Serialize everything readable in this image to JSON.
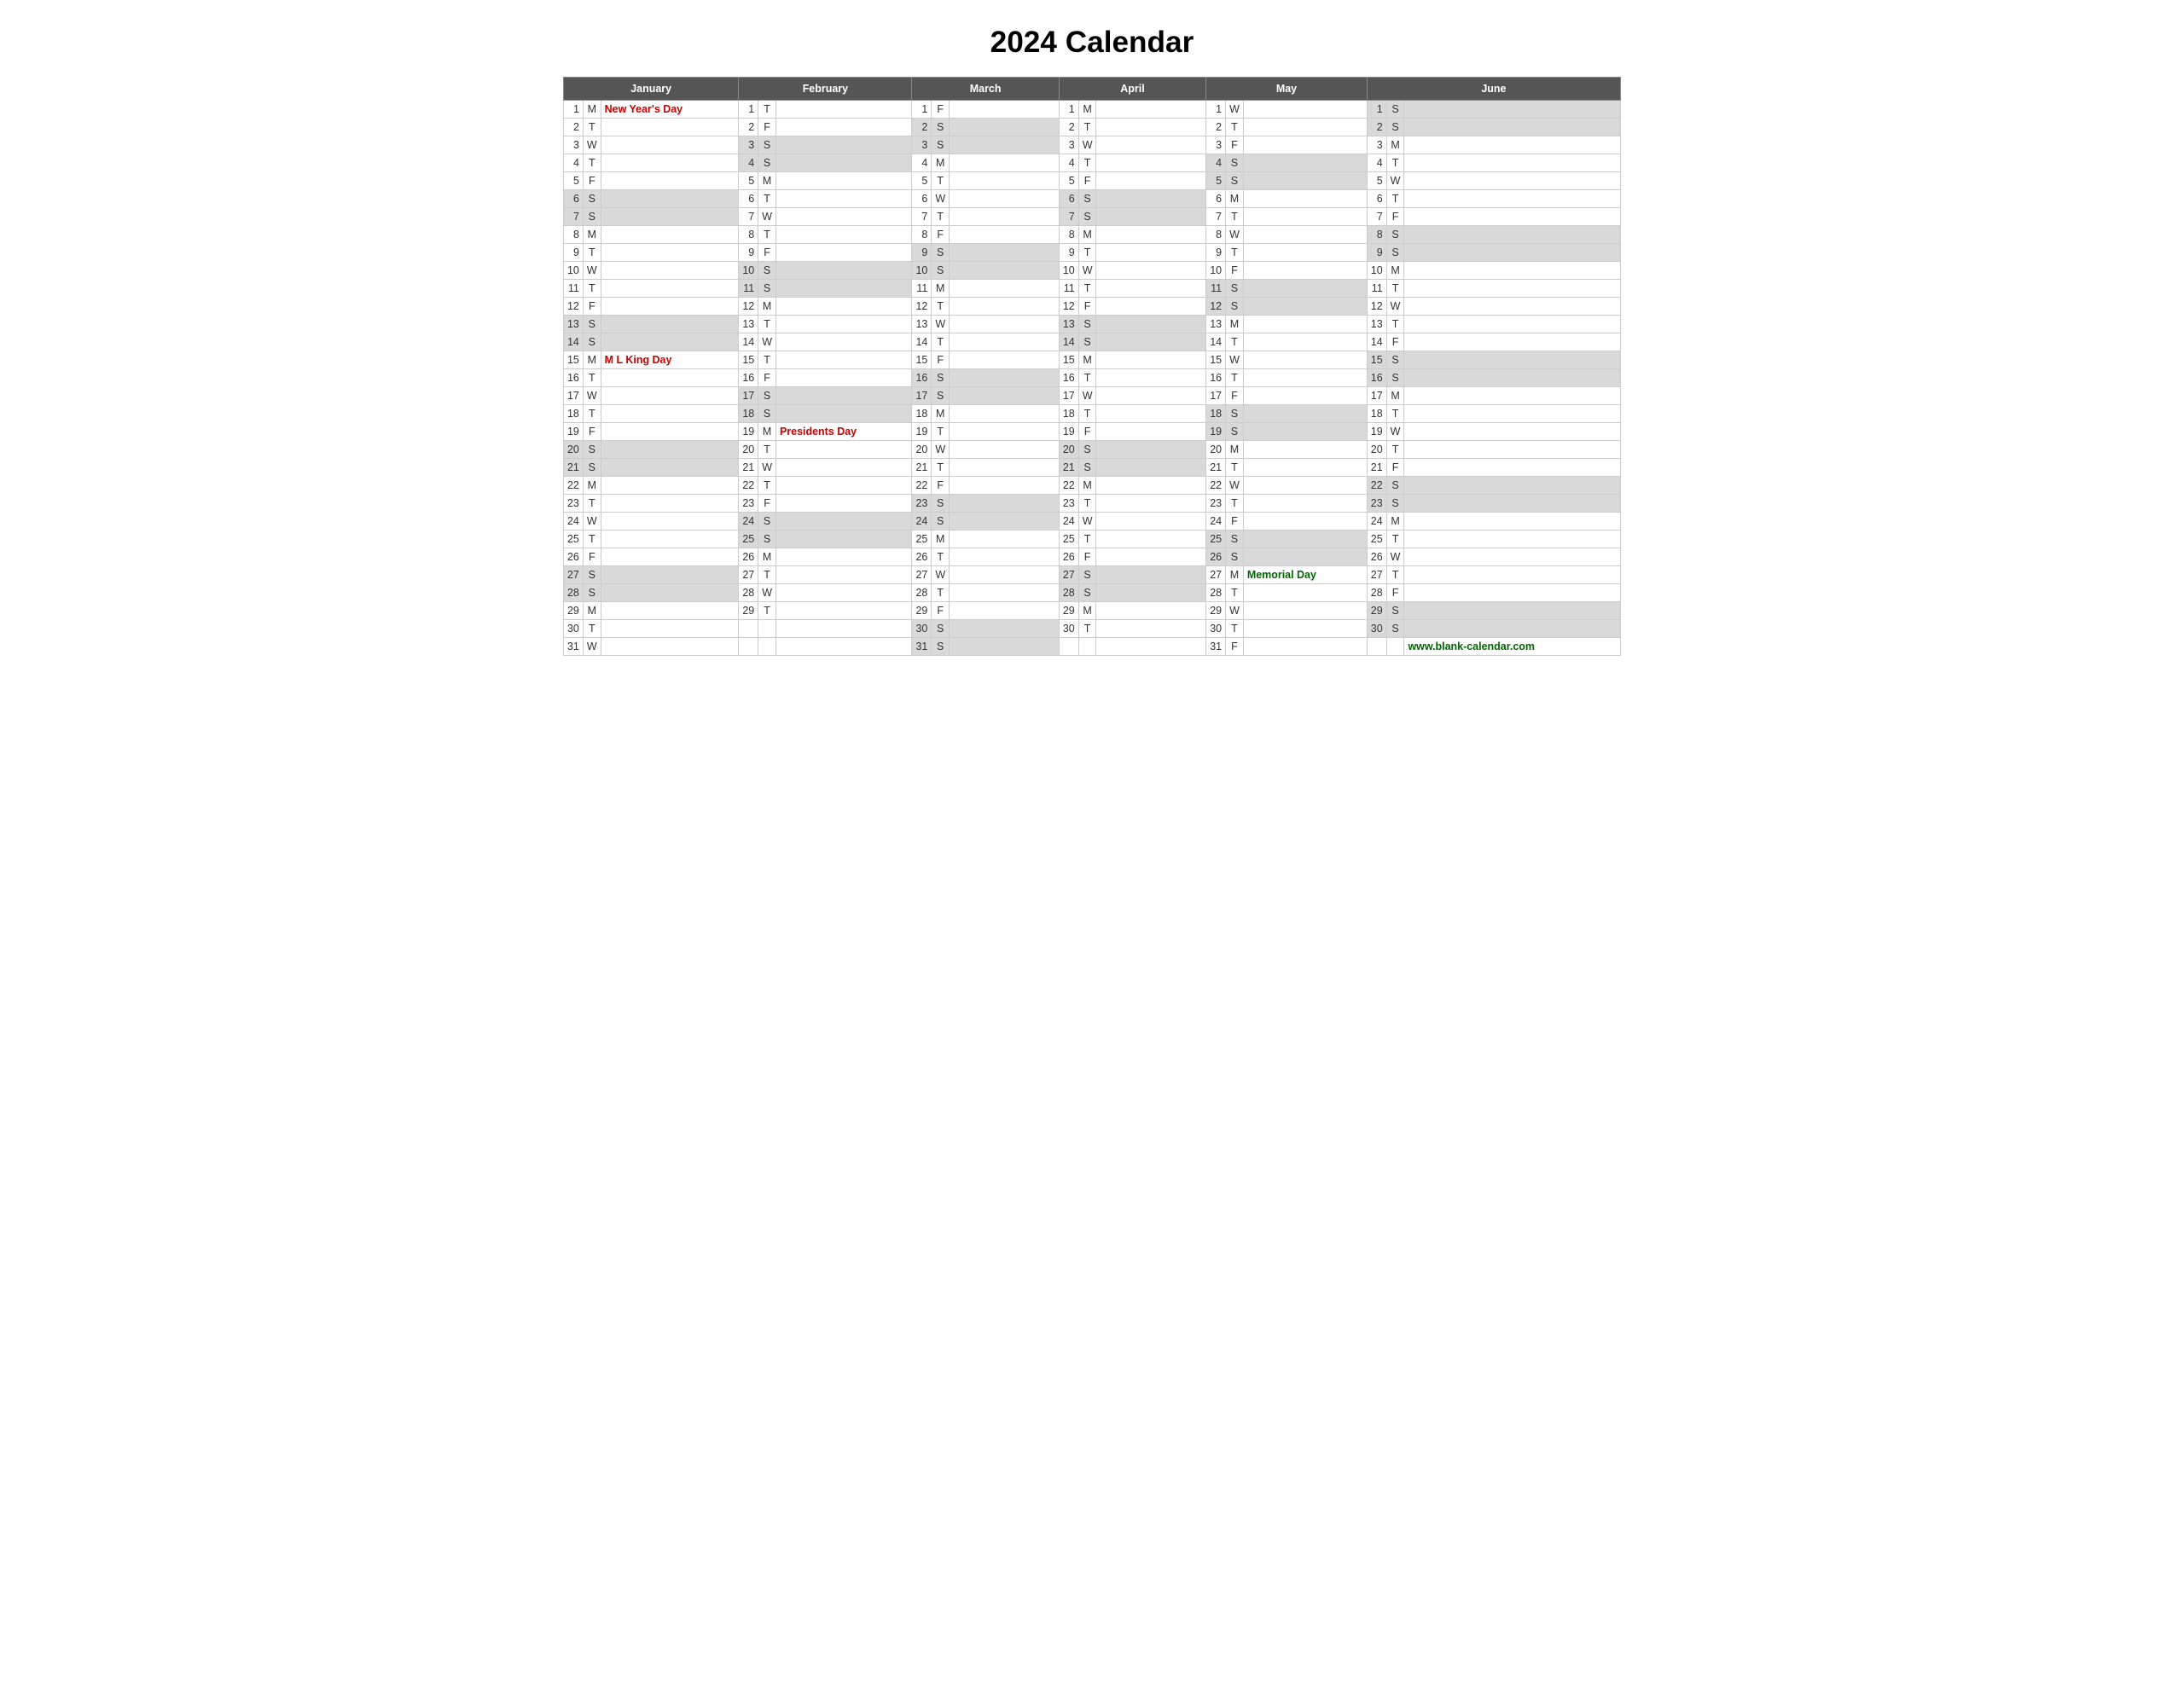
{
  "title": "2024 Calendar",
  "footer": "www.blank-calendar.com",
  "months": [
    "January",
    "February",
    "March",
    "April",
    "May",
    "June"
  ],
  "calendar": {
    "january": [
      {
        "day": 1,
        "letter": "M",
        "event": "New Year's Day",
        "event_class": "holiday-red",
        "weekend": false
      },
      {
        "day": 2,
        "letter": "T",
        "event": "",
        "weekend": false
      },
      {
        "day": 3,
        "letter": "W",
        "event": "",
        "weekend": false
      },
      {
        "day": 4,
        "letter": "T",
        "event": "",
        "weekend": false
      },
      {
        "day": 5,
        "letter": "F",
        "event": "",
        "weekend": false
      },
      {
        "day": 6,
        "letter": "S",
        "event": "",
        "weekend": true
      },
      {
        "day": 7,
        "letter": "S",
        "event": "",
        "weekend": true
      },
      {
        "day": 8,
        "letter": "M",
        "event": "",
        "weekend": false
      },
      {
        "day": 9,
        "letter": "T",
        "event": "",
        "weekend": false
      },
      {
        "day": 10,
        "letter": "W",
        "event": "",
        "weekend": false
      },
      {
        "day": 11,
        "letter": "T",
        "event": "",
        "weekend": false
      },
      {
        "day": 12,
        "letter": "F",
        "event": "",
        "weekend": false
      },
      {
        "day": 13,
        "letter": "S",
        "event": "",
        "weekend": true
      },
      {
        "day": 14,
        "letter": "S",
        "event": "",
        "weekend": true
      },
      {
        "day": 15,
        "letter": "M",
        "event": "M L King Day",
        "event_class": "holiday-red",
        "weekend": false
      },
      {
        "day": 16,
        "letter": "T",
        "event": "",
        "weekend": false
      },
      {
        "day": 17,
        "letter": "W",
        "event": "",
        "weekend": false
      },
      {
        "day": 18,
        "letter": "T",
        "event": "",
        "weekend": false
      },
      {
        "day": 19,
        "letter": "F",
        "event": "",
        "weekend": false
      },
      {
        "day": 20,
        "letter": "S",
        "event": "",
        "weekend": true
      },
      {
        "day": 21,
        "letter": "S",
        "event": "",
        "weekend": true
      },
      {
        "day": 22,
        "letter": "M",
        "event": "",
        "weekend": false
      },
      {
        "day": 23,
        "letter": "T",
        "event": "",
        "weekend": false
      },
      {
        "day": 24,
        "letter": "W",
        "event": "",
        "weekend": false
      },
      {
        "day": 25,
        "letter": "T",
        "event": "",
        "weekend": false
      },
      {
        "day": 26,
        "letter": "F",
        "event": "",
        "weekend": false
      },
      {
        "day": 27,
        "letter": "S",
        "event": "",
        "weekend": true
      },
      {
        "day": 28,
        "letter": "S",
        "event": "",
        "weekend": true
      },
      {
        "day": 29,
        "letter": "M",
        "event": "",
        "weekend": false
      },
      {
        "day": 30,
        "letter": "T",
        "event": "",
        "weekend": false
      },
      {
        "day": 31,
        "letter": "W",
        "event": "",
        "weekend": false
      }
    ],
    "february": [
      {
        "day": 1,
        "letter": "T",
        "event": "",
        "weekend": false
      },
      {
        "day": 2,
        "letter": "F",
        "event": "",
        "weekend": false
      },
      {
        "day": 3,
        "letter": "S",
        "event": "",
        "weekend": true
      },
      {
        "day": 4,
        "letter": "S",
        "event": "",
        "weekend": true
      },
      {
        "day": 5,
        "letter": "M",
        "event": "",
        "weekend": false
      },
      {
        "day": 6,
        "letter": "T",
        "event": "",
        "weekend": false
      },
      {
        "day": 7,
        "letter": "W",
        "event": "",
        "weekend": false
      },
      {
        "day": 8,
        "letter": "T",
        "event": "",
        "weekend": false
      },
      {
        "day": 9,
        "letter": "F",
        "event": "",
        "weekend": false
      },
      {
        "day": 10,
        "letter": "S",
        "event": "",
        "weekend": true
      },
      {
        "day": 11,
        "letter": "S",
        "event": "",
        "weekend": true
      },
      {
        "day": 12,
        "letter": "M",
        "event": "",
        "weekend": false
      },
      {
        "day": 13,
        "letter": "T",
        "event": "",
        "weekend": false
      },
      {
        "day": 14,
        "letter": "W",
        "event": "",
        "weekend": false
      },
      {
        "day": 15,
        "letter": "T",
        "event": "",
        "weekend": false
      },
      {
        "day": 16,
        "letter": "F",
        "event": "",
        "weekend": false
      },
      {
        "day": 17,
        "letter": "S",
        "event": "",
        "weekend": true
      },
      {
        "day": 18,
        "letter": "S",
        "event": "",
        "weekend": true
      },
      {
        "day": 19,
        "letter": "M",
        "event": "Presidents Day",
        "event_class": "holiday-red",
        "weekend": false
      },
      {
        "day": 20,
        "letter": "T",
        "event": "",
        "weekend": false
      },
      {
        "day": 21,
        "letter": "W",
        "event": "",
        "weekend": false
      },
      {
        "day": 22,
        "letter": "T",
        "event": "",
        "weekend": false
      },
      {
        "day": 23,
        "letter": "F",
        "event": "",
        "weekend": false
      },
      {
        "day": 24,
        "letter": "S",
        "event": "",
        "weekend": true
      },
      {
        "day": 25,
        "letter": "S",
        "event": "",
        "weekend": true
      },
      {
        "day": 26,
        "letter": "M",
        "event": "",
        "weekend": false
      },
      {
        "day": 27,
        "letter": "T",
        "event": "",
        "weekend": false
      },
      {
        "day": 28,
        "letter": "W",
        "event": "",
        "weekend": false
      },
      {
        "day": 29,
        "letter": "T",
        "event": "",
        "weekend": false
      }
    ],
    "march": [
      {
        "day": 1,
        "letter": "F",
        "event": "",
        "weekend": false
      },
      {
        "day": 2,
        "letter": "S",
        "event": "",
        "weekend": true
      },
      {
        "day": 3,
        "letter": "S",
        "event": "",
        "weekend": true
      },
      {
        "day": 4,
        "letter": "M",
        "event": "",
        "weekend": false
      },
      {
        "day": 5,
        "letter": "T",
        "event": "",
        "weekend": false
      },
      {
        "day": 6,
        "letter": "W",
        "event": "",
        "weekend": false
      },
      {
        "day": 7,
        "letter": "T",
        "event": "",
        "weekend": false
      },
      {
        "day": 8,
        "letter": "F",
        "event": "",
        "weekend": false
      },
      {
        "day": 9,
        "letter": "S",
        "event": "",
        "weekend": true
      },
      {
        "day": 10,
        "letter": "S",
        "event": "",
        "weekend": true
      },
      {
        "day": 11,
        "letter": "M",
        "event": "",
        "weekend": false
      },
      {
        "day": 12,
        "letter": "T",
        "event": "",
        "weekend": false
      },
      {
        "day": 13,
        "letter": "W",
        "event": "",
        "weekend": false
      },
      {
        "day": 14,
        "letter": "T",
        "event": "",
        "weekend": false
      },
      {
        "day": 15,
        "letter": "F",
        "event": "",
        "weekend": false
      },
      {
        "day": 16,
        "letter": "S",
        "event": "",
        "weekend": true
      },
      {
        "day": 17,
        "letter": "S",
        "event": "",
        "weekend": true
      },
      {
        "day": 18,
        "letter": "M",
        "event": "",
        "weekend": false
      },
      {
        "day": 19,
        "letter": "T",
        "event": "",
        "weekend": false
      },
      {
        "day": 20,
        "letter": "W",
        "event": "",
        "weekend": false
      },
      {
        "day": 21,
        "letter": "T",
        "event": "",
        "weekend": false
      },
      {
        "day": 22,
        "letter": "F",
        "event": "",
        "weekend": false
      },
      {
        "day": 23,
        "letter": "S",
        "event": "",
        "weekend": true
      },
      {
        "day": 24,
        "letter": "S",
        "event": "",
        "weekend": true
      },
      {
        "day": 25,
        "letter": "M",
        "event": "",
        "weekend": false
      },
      {
        "day": 26,
        "letter": "T",
        "event": "",
        "weekend": false
      },
      {
        "day": 27,
        "letter": "W",
        "event": "",
        "weekend": false
      },
      {
        "day": 28,
        "letter": "T",
        "event": "",
        "weekend": false
      },
      {
        "day": 29,
        "letter": "F",
        "event": "",
        "weekend": false
      },
      {
        "day": 30,
        "letter": "S",
        "event": "",
        "weekend": true
      },
      {
        "day": 31,
        "letter": "S",
        "event": "",
        "weekend": true
      }
    ],
    "april": [
      {
        "day": 1,
        "letter": "M",
        "event": "",
        "weekend": false
      },
      {
        "day": 2,
        "letter": "T",
        "event": "",
        "weekend": false
      },
      {
        "day": 3,
        "letter": "W",
        "event": "",
        "weekend": false
      },
      {
        "day": 4,
        "letter": "T",
        "event": "",
        "weekend": false
      },
      {
        "day": 5,
        "letter": "F",
        "event": "",
        "weekend": false
      },
      {
        "day": 6,
        "letter": "S",
        "event": "",
        "weekend": true
      },
      {
        "day": 7,
        "letter": "S",
        "event": "",
        "weekend": true
      },
      {
        "day": 8,
        "letter": "M",
        "event": "",
        "weekend": false
      },
      {
        "day": 9,
        "letter": "T",
        "event": "",
        "weekend": false
      },
      {
        "day": 10,
        "letter": "W",
        "event": "",
        "weekend": false
      },
      {
        "day": 11,
        "letter": "T",
        "event": "",
        "weekend": false
      },
      {
        "day": 12,
        "letter": "F",
        "event": "",
        "weekend": false
      },
      {
        "day": 13,
        "letter": "S",
        "event": "",
        "weekend": true
      },
      {
        "day": 14,
        "letter": "S",
        "event": "",
        "weekend": true
      },
      {
        "day": 15,
        "letter": "M",
        "event": "",
        "weekend": false
      },
      {
        "day": 16,
        "letter": "T",
        "event": "",
        "weekend": false
      },
      {
        "day": 17,
        "letter": "W",
        "event": "",
        "weekend": false
      },
      {
        "day": 18,
        "letter": "T",
        "event": "",
        "weekend": false
      },
      {
        "day": 19,
        "letter": "F",
        "event": "",
        "weekend": false
      },
      {
        "day": 20,
        "letter": "S",
        "event": "",
        "weekend": true
      },
      {
        "day": 21,
        "letter": "S",
        "event": "",
        "weekend": true
      },
      {
        "day": 22,
        "letter": "M",
        "event": "",
        "weekend": false
      },
      {
        "day": 23,
        "letter": "T",
        "event": "",
        "weekend": false
      },
      {
        "day": 24,
        "letter": "W",
        "event": "",
        "weekend": false
      },
      {
        "day": 25,
        "letter": "T",
        "event": "",
        "weekend": false
      },
      {
        "day": 26,
        "letter": "F",
        "event": "",
        "weekend": false
      },
      {
        "day": 27,
        "letter": "S",
        "event": "",
        "weekend": true
      },
      {
        "day": 28,
        "letter": "S",
        "event": "",
        "weekend": true
      },
      {
        "day": 29,
        "letter": "M",
        "event": "",
        "weekend": false
      },
      {
        "day": 30,
        "letter": "T",
        "event": "",
        "weekend": false
      }
    ],
    "may": [
      {
        "day": 1,
        "letter": "W",
        "event": "",
        "weekend": false
      },
      {
        "day": 2,
        "letter": "T",
        "event": "",
        "weekend": false
      },
      {
        "day": 3,
        "letter": "F",
        "event": "",
        "weekend": false
      },
      {
        "day": 4,
        "letter": "S",
        "event": "",
        "weekend": true
      },
      {
        "day": 5,
        "letter": "S",
        "event": "",
        "weekend": true
      },
      {
        "day": 6,
        "letter": "M",
        "event": "",
        "weekend": false
      },
      {
        "day": 7,
        "letter": "T",
        "event": "",
        "weekend": false
      },
      {
        "day": 8,
        "letter": "W",
        "event": "",
        "weekend": false
      },
      {
        "day": 9,
        "letter": "T",
        "event": "",
        "weekend": false
      },
      {
        "day": 10,
        "letter": "F",
        "event": "",
        "weekend": false
      },
      {
        "day": 11,
        "letter": "S",
        "event": "",
        "weekend": true
      },
      {
        "day": 12,
        "letter": "S",
        "event": "",
        "weekend": true
      },
      {
        "day": 13,
        "letter": "M",
        "event": "",
        "weekend": false
      },
      {
        "day": 14,
        "letter": "T",
        "event": "",
        "weekend": false
      },
      {
        "day": 15,
        "letter": "W",
        "event": "",
        "weekend": false
      },
      {
        "day": 16,
        "letter": "T",
        "event": "",
        "weekend": false
      },
      {
        "day": 17,
        "letter": "F",
        "event": "",
        "weekend": false
      },
      {
        "day": 18,
        "letter": "S",
        "event": "",
        "weekend": true
      },
      {
        "day": 19,
        "letter": "S",
        "event": "",
        "weekend": true
      },
      {
        "day": 20,
        "letter": "M",
        "event": "",
        "weekend": false
      },
      {
        "day": 21,
        "letter": "T",
        "event": "",
        "weekend": false
      },
      {
        "day": 22,
        "letter": "W",
        "event": "",
        "weekend": false
      },
      {
        "day": 23,
        "letter": "T",
        "event": "",
        "weekend": false
      },
      {
        "day": 24,
        "letter": "F",
        "event": "",
        "weekend": false
      },
      {
        "day": 25,
        "letter": "S",
        "event": "",
        "weekend": true
      },
      {
        "day": 26,
        "letter": "S",
        "event": "",
        "weekend": true
      },
      {
        "day": 27,
        "letter": "M",
        "event": "Memorial Day",
        "event_class": "holiday-green",
        "weekend": false
      },
      {
        "day": 28,
        "letter": "T",
        "event": "",
        "weekend": false
      },
      {
        "day": 29,
        "letter": "W",
        "event": "",
        "weekend": false
      },
      {
        "day": 30,
        "letter": "T",
        "event": "",
        "weekend": false
      },
      {
        "day": 31,
        "letter": "F",
        "event": "",
        "weekend": false
      }
    ],
    "june": [
      {
        "day": 1,
        "letter": "S",
        "event": "",
        "weekend": true
      },
      {
        "day": 2,
        "letter": "S",
        "event": "",
        "weekend": true
      },
      {
        "day": 3,
        "letter": "M",
        "event": "",
        "weekend": false
      },
      {
        "day": 4,
        "letter": "T",
        "event": "",
        "weekend": false
      },
      {
        "day": 5,
        "letter": "W",
        "event": "",
        "weekend": false
      },
      {
        "day": 6,
        "letter": "T",
        "event": "",
        "weekend": false
      },
      {
        "day": 7,
        "letter": "F",
        "event": "",
        "weekend": false
      },
      {
        "day": 8,
        "letter": "S",
        "event": "",
        "weekend": true
      },
      {
        "day": 9,
        "letter": "S",
        "event": "",
        "weekend": true
      },
      {
        "day": 10,
        "letter": "M",
        "event": "",
        "weekend": false
      },
      {
        "day": 11,
        "letter": "T",
        "event": "",
        "weekend": false
      },
      {
        "day": 12,
        "letter": "W",
        "event": "",
        "weekend": false
      },
      {
        "day": 13,
        "letter": "T",
        "event": "",
        "weekend": false
      },
      {
        "day": 14,
        "letter": "F",
        "event": "",
        "weekend": false
      },
      {
        "day": 15,
        "letter": "S",
        "event": "",
        "weekend": true
      },
      {
        "day": 16,
        "letter": "S",
        "event": "",
        "weekend": true
      },
      {
        "day": 17,
        "letter": "M",
        "event": "",
        "weekend": false
      },
      {
        "day": 18,
        "letter": "T",
        "event": "",
        "weekend": false
      },
      {
        "day": 19,
        "letter": "W",
        "event": "",
        "weekend": false
      },
      {
        "day": 20,
        "letter": "T",
        "event": "",
        "weekend": false
      },
      {
        "day": 21,
        "letter": "F",
        "event": "",
        "weekend": false
      },
      {
        "day": 22,
        "letter": "S",
        "event": "",
        "weekend": true
      },
      {
        "day": 23,
        "letter": "S",
        "event": "",
        "weekend": true
      },
      {
        "day": 24,
        "letter": "M",
        "event": "",
        "weekend": false
      },
      {
        "day": 25,
        "letter": "T",
        "event": "",
        "weekend": false
      },
      {
        "day": 26,
        "letter": "W",
        "event": "",
        "weekend": false
      },
      {
        "day": 27,
        "letter": "T",
        "event": "",
        "weekend": false
      },
      {
        "day": 28,
        "letter": "F",
        "event": "",
        "weekend": false
      },
      {
        "day": 29,
        "letter": "S",
        "event": "",
        "weekend": true
      },
      {
        "day": 30,
        "letter": "S",
        "event": "",
        "weekend": true
      }
    ]
  }
}
